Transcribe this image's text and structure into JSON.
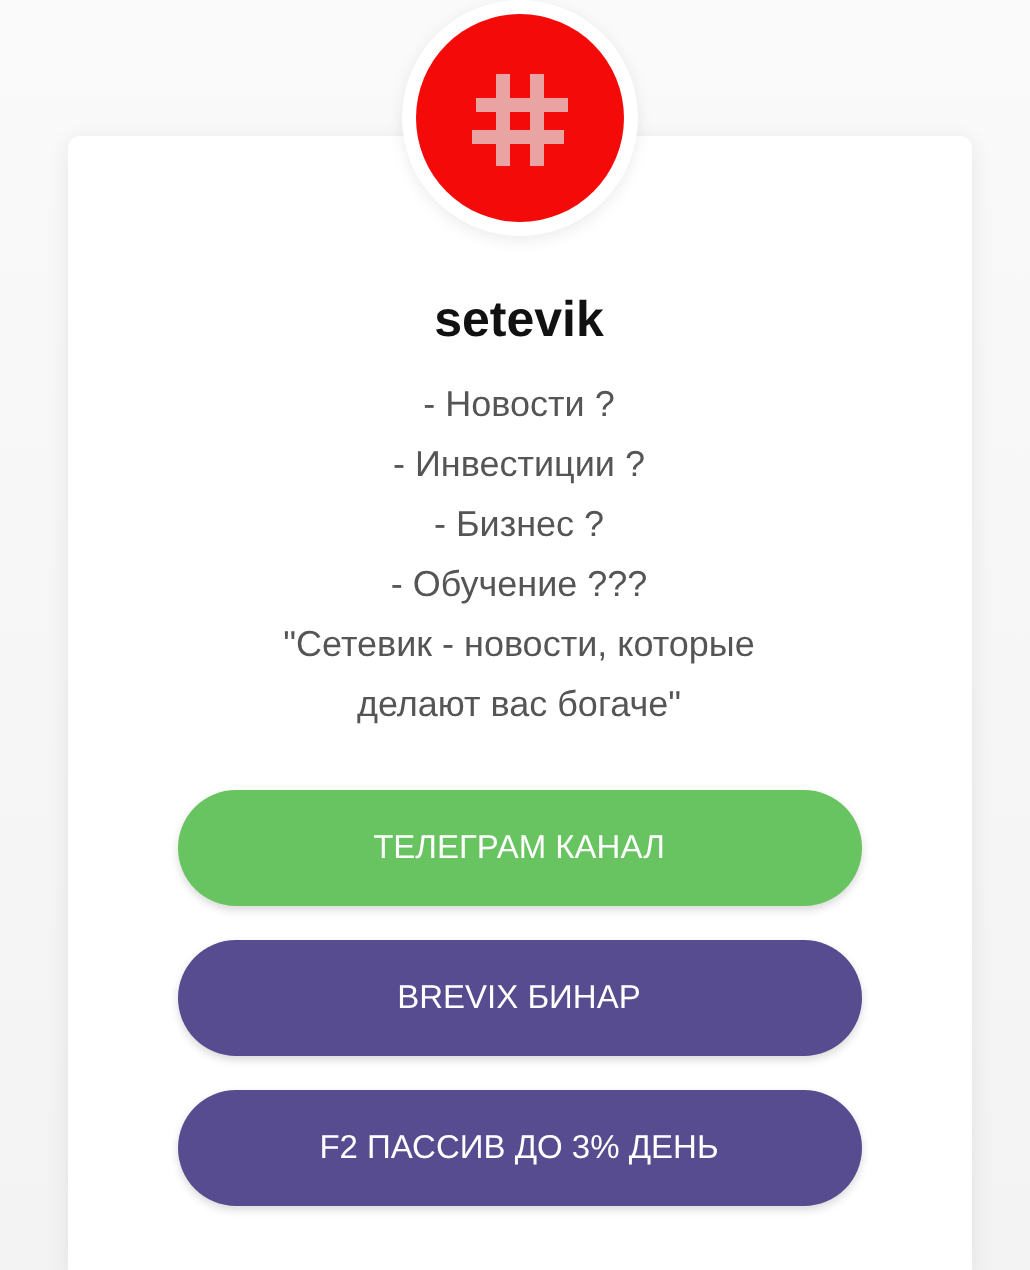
{
  "profile": {
    "name": "setevik",
    "description_lines": [
      "- Новости ?",
      "- Инвестиции ?",
      "- Бизнес ?",
      "- Обучение ???",
      "\"Сетевик - новости, которые",
      "делают вас богаче\""
    ]
  },
  "links": [
    {
      "label": "ТЕЛЕГРАМ КАНАЛ",
      "color": "#68c461"
    },
    {
      "label": "BREVIX БИНАР",
      "color": "#574c8f"
    },
    {
      "label": "F2 ПАССИВ ДО 3% ДЕНЬ",
      "color": "#574c8f"
    }
  ]
}
